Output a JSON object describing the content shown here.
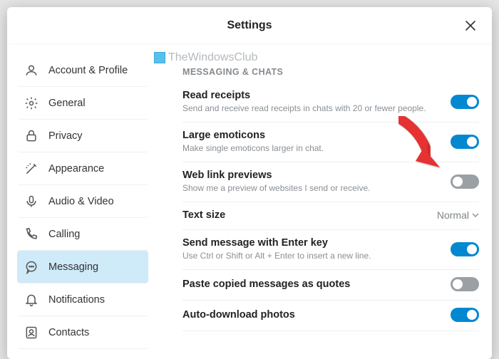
{
  "header": {
    "title": "Settings"
  },
  "watermark": "TheWindowsClub",
  "sidebar": {
    "items": [
      {
        "label": "Account & Profile"
      },
      {
        "label": "General"
      },
      {
        "label": "Privacy"
      },
      {
        "label": "Appearance"
      },
      {
        "label": "Audio & Video"
      },
      {
        "label": "Calling"
      },
      {
        "label": "Messaging"
      },
      {
        "label": "Notifications"
      },
      {
        "label": "Contacts"
      }
    ]
  },
  "content": {
    "section_title": "MESSAGING & CHATS",
    "rows": {
      "read_receipts": {
        "title": "Read receipts",
        "sub": "Send and receive read receipts in chats with 20 or fewer people."
      },
      "large_emoticons": {
        "title": "Large emoticons",
        "sub": "Make single emoticons larger in chat."
      },
      "web_link_previews": {
        "title": "Web link previews",
        "sub": "Show me a preview of websites I send or receive."
      },
      "text_size": {
        "title": "Text size",
        "value": "Normal"
      },
      "send_with_enter": {
        "title": "Send message with Enter key",
        "sub": "Use Ctrl or Shift or Alt + Enter to insert a new line."
      },
      "paste_quotes": {
        "title": "Paste copied messages as quotes"
      },
      "auto_download": {
        "title": "Auto-download photos"
      }
    }
  },
  "toggles": {
    "read_receipts": true,
    "large_emoticons": true,
    "web_link_previews": false,
    "send_with_enter": true,
    "paste_quotes": false,
    "auto_download": true
  }
}
